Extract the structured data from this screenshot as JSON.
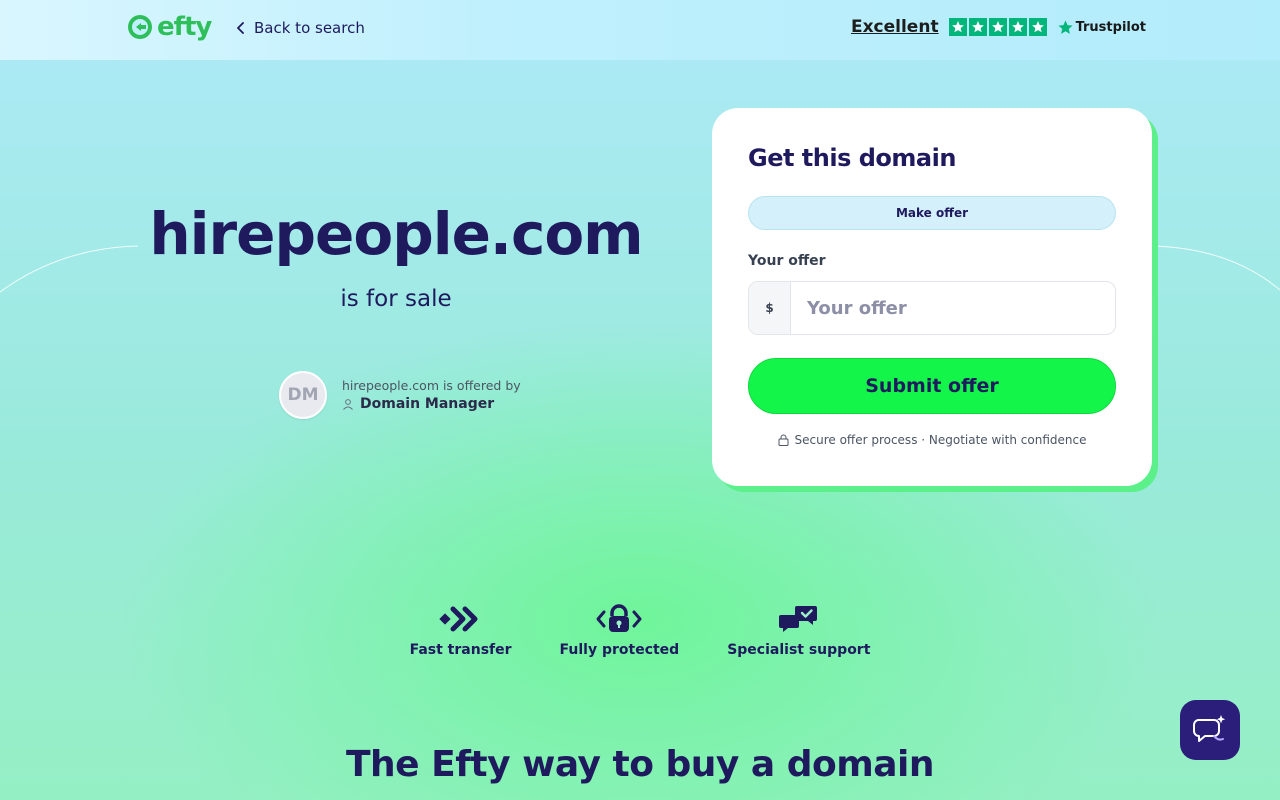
{
  "header": {
    "logo_text": "efty",
    "back_label": "Back to search",
    "rating_word": "Excellent",
    "rating_stars": 5,
    "rating_brand": "Trustpilot"
  },
  "hero": {
    "domain": "hirepeople.com",
    "subtitle": "is for sale",
    "seller_initials": "DM",
    "offered_by": "hirepeople.com is offered by",
    "seller_name": "Domain Manager"
  },
  "card": {
    "title": "Get this domain",
    "tab_label": "Make offer",
    "offer_label": "Your offer",
    "currency_symbol": "$",
    "offer_placeholder": "Your offer",
    "offer_value": "",
    "submit_label": "Submit offer",
    "secure_note": "Secure offer process · Negotiate with confidence"
  },
  "features": [
    {
      "label": "Fast transfer",
      "icon": "fast-transfer-icon"
    },
    {
      "label": "Fully protected",
      "icon": "lock-shield-icon"
    },
    {
      "label": "Specialist support",
      "icon": "chat-support-icon"
    }
  ],
  "section": {
    "title": "The Efty way to buy a domain"
  },
  "colors": {
    "brand_navy": "#1f1a5e",
    "brand_green": "#14f54a",
    "trustpilot_green": "#00b67a",
    "chat_button": "#2b1e7a"
  }
}
